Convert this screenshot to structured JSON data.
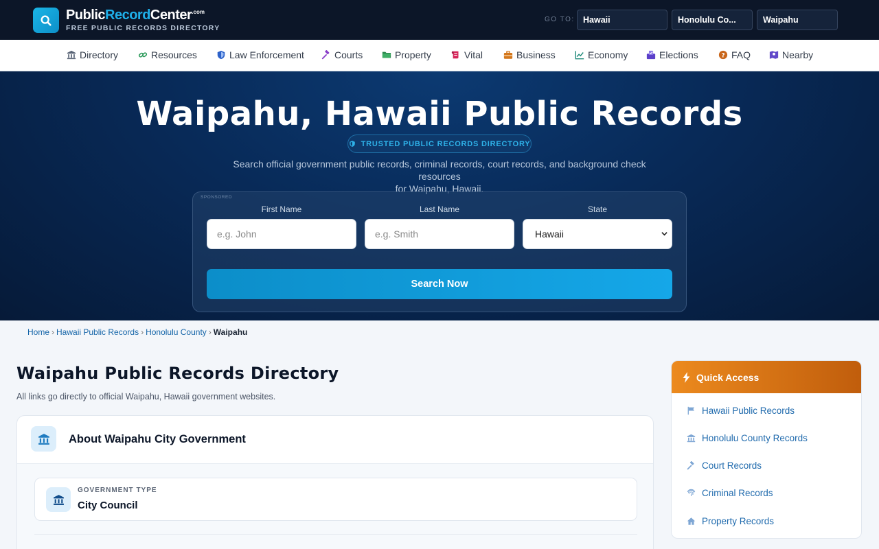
{
  "brand": {
    "name_part1": "Public",
    "name_part2": "Record",
    "name_part3": "Center",
    "tld": ".com",
    "tagline": "FREE PUBLIC RECORDS DIRECTORY"
  },
  "goto": {
    "label": "GO TO:",
    "state": "Hawaii",
    "county": "Honolulu Co...",
    "city": "Waipahu"
  },
  "nav": [
    {
      "label": "Directory",
      "icon": "landmark-icon"
    },
    {
      "label": "Resources",
      "icon": "link-icon"
    },
    {
      "label": "Law Enforcement",
      "icon": "shield-icon"
    },
    {
      "label": "Courts",
      "icon": "gavel-icon"
    },
    {
      "label": "Property",
      "icon": "folder-icon"
    },
    {
      "label": "Vital",
      "icon": "scroll-icon"
    },
    {
      "label": "Business",
      "icon": "briefcase-icon"
    },
    {
      "label": "Economy",
      "icon": "chart-line-icon"
    },
    {
      "label": "Elections",
      "icon": "vote-icon"
    },
    {
      "label": "FAQ",
      "icon": "question-icon"
    },
    {
      "label": "Nearby",
      "icon": "map-icon"
    }
  ],
  "hero": {
    "title": "Waipahu, Hawaii Public Records",
    "badge": "TRUSTED PUBLIC RECORDS DIRECTORY",
    "description_line1": "Search official government public records, criminal records, court records, and background check resources",
    "description_line2": "for Waipahu, Hawaii."
  },
  "search": {
    "sponsored": "SPONSORED",
    "first_name_label": "First Name",
    "first_name_placeholder": "e.g. John",
    "last_name_label": "Last Name",
    "last_name_placeholder": "e.g. Smith",
    "state_label": "State",
    "state_value": "Hawaii",
    "button": "Search Now"
  },
  "breadcrumb": {
    "home": "Home",
    "state": "Hawaii Public Records",
    "county": "Honolulu County",
    "current": "Waipahu",
    "separator": "›"
  },
  "main": {
    "title": "Waipahu Public Records Directory",
    "subtitle": "All links go directly to official Waipahu, Hawaii government websites.",
    "about_title": "About Waipahu City Government",
    "gov_type_label": "GOVERNMENT TYPE",
    "gov_type_value": "City Council"
  },
  "quick_access": {
    "title": "Quick Access",
    "items": [
      {
        "label": "Hawaii Public Records",
        "icon": "flag-icon"
      },
      {
        "label": "Honolulu County Records",
        "icon": "landmark-icon"
      },
      {
        "label": "Court Records",
        "icon": "gavel-icon"
      },
      {
        "label": "Criminal Records",
        "icon": "fingerprint-icon"
      },
      {
        "label": "Property Records",
        "icon": "home-icon"
      }
    ]
  },
  "colors": {
    "topbar": "#0c1628",
    "accent_blue": "#15a7e8",
    "link_blue": "#1f6aad",
    "quick_access_orange": "#ec8a1e"
  }
}
